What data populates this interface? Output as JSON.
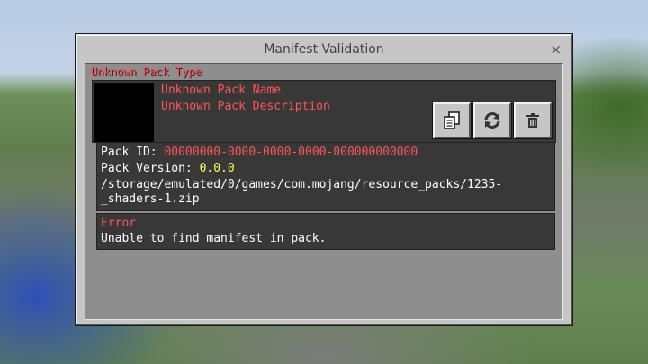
{
  "dialog": {
    "title": "Manifest Validation",
    "close_label": "×"
  },
  "pack": {
    "type_label": "Unknown Pack Type",
    "name": "Unknown Pack Name",
    "description": "Unknown Pack Description",
    "id_label": "Pack ID:",
    "id_value": "00000000-0000-0000-0000-000000000000",
    "version_label": "Pack Version:",
    "version_value": "0.0.0",
    "path_line1": "/storage/emulated/0/games/com.mojang/resource_packs/1235-",
    "path_line2": "_shaders-1.zip"
  },
  "buttons": {
    "copy_icon": "copy-icon",
    "refresh_icon": "refresh-icon",
    "delete_icon": "trash-icon"
  },
  "error": {
    "label": "Error",
    "message": "Unable to find manifest in pack."
  },
  "colors": {
    "error_red": "#ff5555",
    "version_yellow": "#ffff55",
    "panel_dark": "#383838",
    "dialog_gray": "#c6c6c6"
  }
}
